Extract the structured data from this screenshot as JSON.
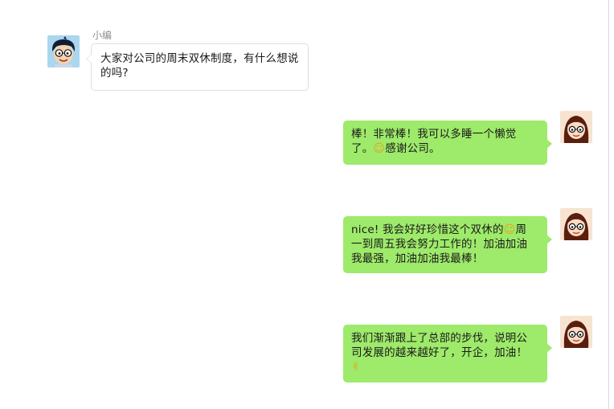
{
  "colors": {
    "outgoing_bubble": "#9eea6a",
    "incoming_bubble": "#ffffff",
    "incoming_border": "#dedede",
    "sender_name": "#8c8c8c"
  },
  "chat": {
    "incoming": {
      "sender_name": "小编",
      "avatar_icon": "boy-cartoon-avatar",
      "text": "大家对公司的周末双休制度，有什么想说的吗?"
    },
    "outgoing": [
      {
        "avatar_icon": "girl-cartoon-avatar",
        "line1": "棒！非常棒！我可以多睡一个懒觉",
        "line2_a": "了。",
        "emoji": "☺",
        "emoji_name": "flower-smile-emoji",
        "line2_b": "感谢公司。"
      },
      {
        "avatar_icon": "girl-cartoon-avatar",
        "line1_a": "nice! 我会好好珍惜这个双休的",
        "emoji": "☺",
        "emoji_name": "smile-emoji",
        "line1_b": "周",
        "line2": "一到周五我会努力工作的！加油加油",
        "line3": "我最强，加油加油我最棒！"
      },
      {
        "avatar_icon": "girl-cartoon-avatar",
        "line1": "我们渐渐跟上了总部的步伐，说明公",
        "line2": "司发展的越来越好了，开企，加油！",
        "emoji": "✌",
        "emoji_name": "victory-hand-emoji"
      }
    ]
  }
}
